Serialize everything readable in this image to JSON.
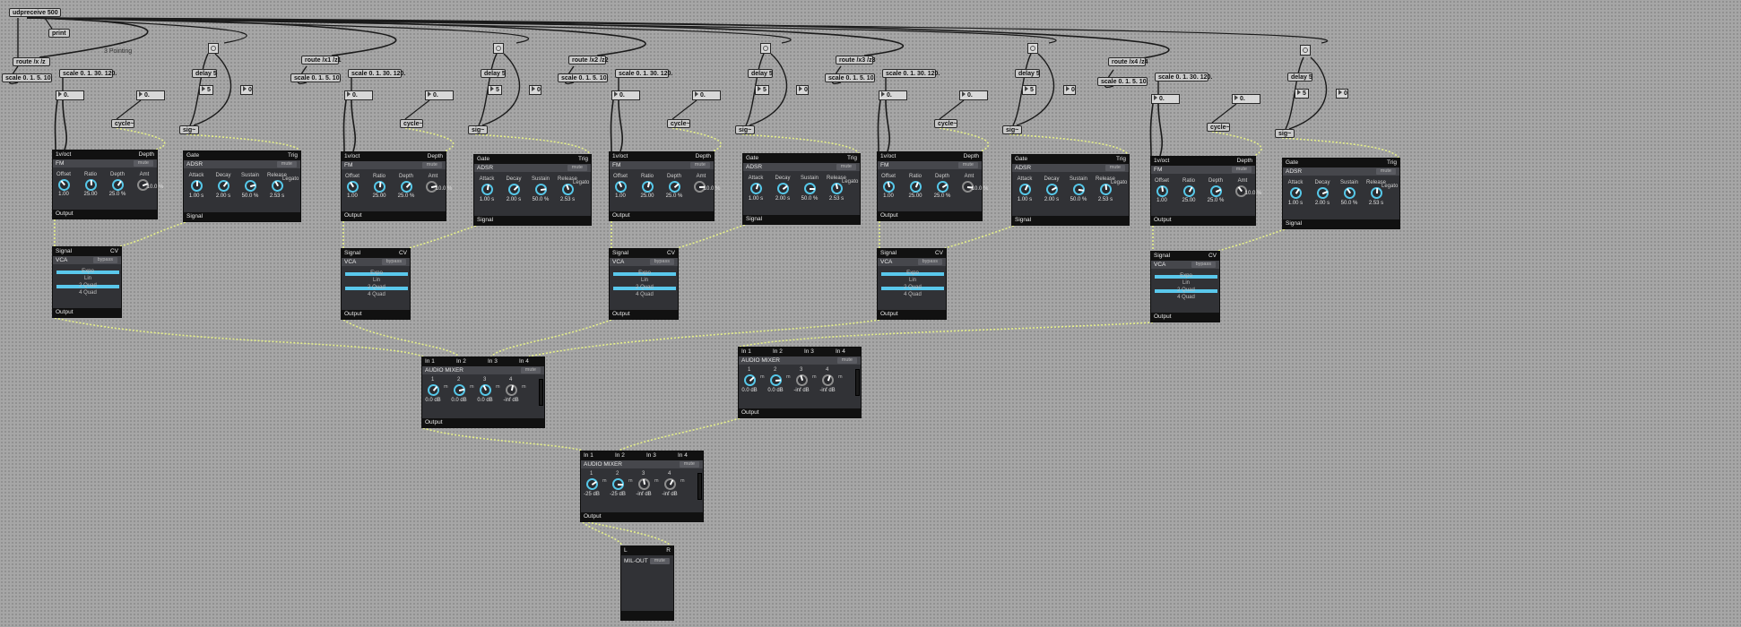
{
  "patch": {
    "udpreceive": "udpreceive 500",
    "print": "print",
    "comment_drag": "3  Pointing",
    "channels": [
      {
        "route": "route /x /z",
        "scale1": "scale 0. 1. 5. 10.",
        "scale2": "scale 0. 1. 30. 120.",
        "delay": "delay 5",
        "cycle": "cycle~",
        "sig": "sig~",
        "num_a": "0.",
        "num_b": "0.",
        "int_a": "5",
        "int_b": "0"
      },
      {
        "route": "route /x1 /z1",
        "scale1": "scale 0. 1. 5. 10.",
        "scale2": "scale 0. 1. 30. 120.",
        "delay": "delay 5",
        "cycle": "cycle~",
        "sig": "sig~",
        "num_a": "0.",
        "num_b": "0.",
        "int_a": "5",
        "int_b": "0"
      },
      {
        "route": "route /x2 /z2",
        "scale1": "scale 0. 1. 5. 10.",
        "scale2": "scale 0. 1. 30. 120.",
        "delay": "delay 5",
        "cycle": "cycle~",
        "sig": "sig~",
        "num_a": "0.",
        "num_b": "0.",
        "int_a": "5",
        "int_b": "0"
      },
      {
        "route": "route /x3 /z3",
        "scale1": "scale 0. 1. 5. 10.",
        "scale2": "scale 0. 1. 30. 120.",
        "delay": "delay 5",
        "cycle": "cycle~",
        "sig": "sig~",
        "num_a": "0.",
        "num_b": "0.",
        "int_a": "5",
        "int_b": "0"
      },
      {
        "route": "route /x4 /z4",
        "scale1": "scale 0. 1. 5. 10.",
        "scale2": "scale 0. 1. 30. 120.",
        "delay": "delay 5",
        "cycle": "cycle~",
        "sig": "sig~",
        "num_a": "0.",
        "num_b": "0.",
        "int_a": "5",
        "int_b": "0"
      }
    ]
  },
  "fm": {
    "in_left": "1v/oct",
    "in_right": "Depth",
    "title": "FM",
    "mute": "mute",
    "out": "Output",
    "knobs": [
      {
        "label": "Offset",
        "value": "1.00"
      },
      {
        "label": "Ratio",
        "value": "25.00"
      },
      {
        "label": "Depth",
        "value": "25.0 %"
      },
      {
        "label": "Amt",
        "value": "10.0 %"
      }
    ]
  },
  "adsr": {
    "in_left": "Gate",
    "in_right": "Trig",
    "title": "ADSR",
    "mute": "mute",
    "out": "Signal",
    "legato": "Legato",
    "knobs": [
      {
        "label": "Attack",
        "value": "1.00 s"
      },
      {
        "label": "Decay",
        "value": "2.00 s"
      },
      {
        "label": "Sustain",
        "value": "50.0 %"
      },
      {
        "label": "Release",
        "value": "2.53 s"
      }
    ]
  },
  "vca": {
    "in_left": "Signal",
    "in_right": "CV",
    "title": "VCA",
    "mute": "bypass",
    "out": "Output",
    "options": [
      "Expo",
      "Lin",
      "2 Quad",
      "4 Quad"
    ]
  },
  "mixers": [
    {
      "inputs": [
        "In 1",
        "In 2",
        "In 3",
        "In 4"
      ],
      "title": "AUDIO MIXER",
      "mute": "mute",
      "out": "Output",
      "channels": [
        {
          "n": "1",
          "v": "0.0 dB"
        },
        {
          "n": "2",
          "v": "0.0 dB"
        },
        {
          "n": "3",
          "v": "0.0 dB"
        },
        {
          "n": "4",
          "v": "-inf dB"
        }
      ]
    },
    {
      "inputs": [
        "In 1",
        "In 2",
        "In 3",
        "In 4"
      ],
      "title": "AUDIO MIXER",
      "mute": "mute",
      "out": "Output",
      "channels": [
        {
          "n": "1",
          "v": "0.0 dB"
        },
        {
          "n": "2",
          "v": "0.0 dB"
        },
        {
          "n": "3",
          "v": "-inf dB"
        },
        {
          "n": "4",
          "v": "-inf dB"
        }
      ]
    },
    {
      "inputs": [
        "In 1",
        "In 2",
        "In 3",
        "In 4"
      ],
      "title": "AUDIO MIXER",
      "mute": "mute",
      "out": "Output",
      "channels": [
        {
          "n": "1",
          "v": "-25 dB"
        },
        {
          "n": "2",
          "v": "-25 dB"
        },
        {
          "n": "3",
          "v": "-inf dB"
        },
        {
          "n": "4",
          "v": "-inf dB"
        }
      ]
    }
  ],
  "mixer_channel_mark": "m",
  "out_module": {
    "in_left": "L",
    "in_right": "R",
    "title": "MIL-OUT",
    "mute": "mute"
  },
  "colors": {
    "accent": "#5ac8ec",
    "module_bg": "#313236",
    "canvas": "#a6a6a6",
    "cable_signal": "#e6f08a"
  }
}
